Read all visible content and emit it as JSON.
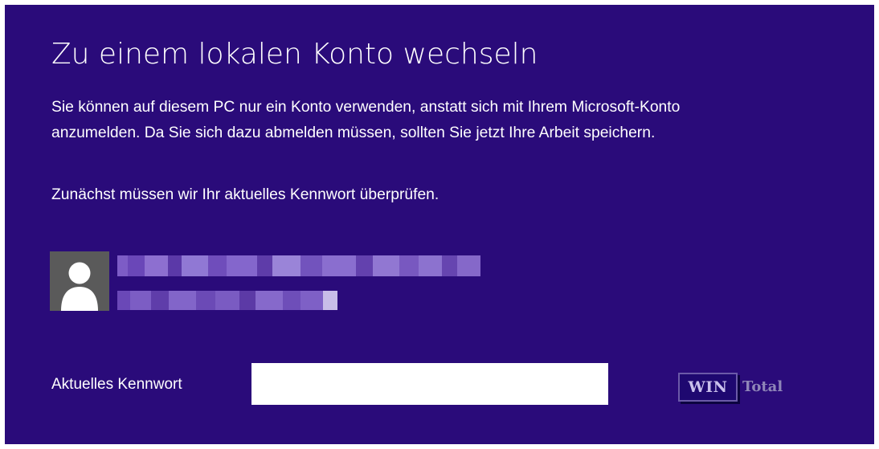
{
  "dialog": {
    "title": "Zu einem lokalen Konto wechseln",
    "description_line1": "Sie können auf diesem PC nur ein Konto verwenden, anstatt sich mit Ihrem Microsoft-Konto",
    "description_line2": "anzumelden. Da Sie sich dazu abmelden müssen, sollten Sie jetzt Ihre Arbeit speichern.",
    "verify_text": "Zunächst müssen wir Ihr aktuelles Kennwort überprüfen."
  },
  "account": {
    "avatar_icon": "user-silhouette-icon",
    "email_obscured": true,
    "name_obscured": true
  },
  "password": {
    "label": "Aktuelles Kennwort",
    "value": "",
    "placeholder": ""
  },
  "watermark": {
    "part1": "WIN",
    "part2": "Total"
  },
  "colors": {
    "background": "#2a0b7a",
    "text": "#ffffff",
    "avatar_bg": "#5a5a5a",
    "input_bg": "#ffffff"
  }
}
